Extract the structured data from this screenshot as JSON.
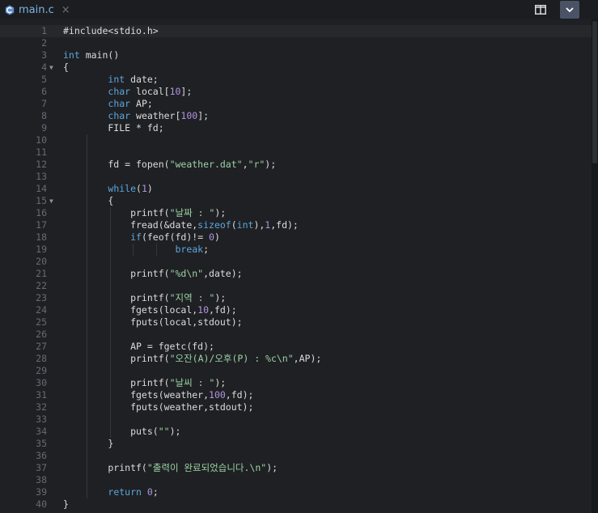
{
  "tab": {
    "filename": "main.c",
    "close_glyph": "×",
    "icon": "c-file-icon"
  },
  "toolbar": {
    "split_icon": "split-layout-icon",
    "dropdown_icon": "chevron-down-icon"
  },
  "colors": {
    "keyword": "#5ba6df",
    "number": "#b294e0",
    "string": "#9bd2a5",
    "text": "#dcdcdc",
    "tab_text": "#7fb2e5",
    "line_number": "#646b76"
  },
  "current_line": 1,
  "fold_lines": [
    4,
    15
  ],
  "lines": [
    [
      {
        "t": "#include<stdio.h>",
        "c": "plain"
      }
    ],
    [],
    [
      {
        "t": "int",
        "c": "kw"
      },
      {
        "t": " main()",
        "c": "plain"
      }
    ],
    [
      {
        "t": "{",
        "c": "plain"
      }
    ],
    [
      {
        "t": "        ",
        "c": "plain"
      },
      {
        "t": "int",
        "c": "kw"
      },
      {
        "t": " date;",
        "c": "plain"
      }
    ],
    [
      {
        "t": "        ",
        "c": "plain"
      },
      {
        "t": "char",
        "c": "kw"
      },
      {
        "t": " local[",
        "c": "plain"
      },
      {
        "t": "10",
        "c": "num"
      },
      {
        "t": "];",
        "c": "plain"
      }
    ],
    [
      {
        "t": "        ",
        "c": "plain"
      },
      {
        "t": "char",
        "c": "kw"
      },
      {
        "t": " AP;",
        "c": "plain"
      }
    ],
    [
      {
        "t": "        ",
        "c": "plain"
      },
      {
        "t": "char",
        "c": "kw"
      },
      {
        "t": " weather[",
        "c": "plain"
      },
      {
        "t": "100",
        "c": "num"
      },
      {
        "t": "];",
        "c": "plain"
      }
    ],
    [
      {
        "t": "        FILE * fd;",
        "c": "plain"
      }
    ],
    [],
    [],
    [
      {
        "t": "        fd = fopen(",
        "c": "plain"
      },
      {
        "t": "\"weather.dat\"",
        "c": "str"
      },
      {
        "t": ",",
        "c": "plain"
      },
      {
        "t": "\"r\"",
        "c": "str"
      },
      {
        "t": ");",
        "c": "plain"
      }
    ],
    [],
    [
      {
        "t": "        ",
        "c": "plain"
      },
      {
        "t": "while",
        "c": "kw"
      },
      {
        "t": "(",
        "c": "plain"
      },
      {
        "t": "1",
        "c": "num"
      },
      {
        "t": ")",
        "c": "plain"
      }
    ],
    [
      {
        "t": "        {",
        "c": "plain"
      }
    ],
    [
      {
        "t": "            printf(",
        "c": "plain"
      },
      {
        "t": "\"날짜 : \"",
        "c": "str"
      },
      {
        "t": ");",
        "c": "plain"
      }
    ],
    [
      {
        "t": "            fread(&date,",
        "c": "plain"
      },
      {
        "t": "sizeof",
        "c": "kw"
      },
      {
        "t": "(",
        "c": "plain"
      },
      {
        "t": "int",
        "c": "kw"
      },
      {
        "t": "),",
        "c": "plain"
      },
      {
        "t": "1",
        "c": "num"
      },
      {
        "t": ",fd);",
        "c": "plain"
      }
    ],
    [
      {
        "t": "            ",
        "c": "plain"
      },
      {
        "t": "if",
        "c": "kw"
      },
      {
        "t": "(feof(fd)!= ",
        "c": "plain"
      },
      {
        "t": "0",
        "c": "num"
      },
      {
        "t": ")",
        "c": "plain"
      }
    ],
    [
      {
        "t": "                    ",
        "c": "plain"
      },
      {
        "t": "break",
        "c": "kw"
      },
      {
        "t": ";",
        "c": "plain"
      }
    ],
    [],
    [
      {
        "t": "            printf(",
        "c": "plain"
      },
      {
        "t": "\"%d\\n\"",
        "c": "str"
      },
      {
        "t": ",date);",
        "c": "plain"
      }
    ],
    [],
    [
      {
        "t": "            printf(",
        "c": "plain"
      },
      {
        "t": "\"지역 : \"",
        "c": "str"
      },
      {
        "t": ");",
        "c": "plain"
      }
    ],
    [
      {
        "t": "            fgets(local,",
        "c": "plain"
      },
      {
        "t": "10",
        "c": "num"
      },
      {
        "t": ",fd);",
        "c": "plain"
      }
    ],
    [
      {
        "t": "            fputs(local,stdout);",
        "c": "plain"
      }
    ],
    [],
    [
      {
        "t": "            AP = fgetc(fd);",
        "c": "plain"
      }
    ],
    [
      {
        "t": "            printf(",
        "c": "plain"
      },
      {
        "t": "\"오잔(A)/오후(P) : %c\\n\"",
        "c": "str"
      },
      {
        "t": ",AP);",
        "c": "plain"
      }
    ],
    [],
    [
      {
        "t": "            printf(",
        "c": "plain"
      },
      {
        "t": "\"날씨 : \"",
        "c": "str"
      },
      {
        "t": ");",
        "c": "plain"
      }
    ],
    [
      {
        "t": "            fgets(weather,",
        "c": "plain"
      },
      {
        "t": "100",
        "c": "num"
      },
      {
        "t": ",fd);",
        "c": "plain"
      }
    ],
    [
      {
        "t": "            fputs(weather,stdout);",
        "c": "plain"
      }
    ],
    [],
    [
      {
        "t": "            puts(",
        "c": "plain"
      },
      {
        "t": "\"\"",
        "c": "str"
      },
      {
        "t": ");",
        "c": "plain"
      }
    ],
    [
      {
        "t": "        }",
        "c": "plain"
      }
    ],
    [],
    [
      {
        "t": "        printf(",
        "c": "plain"
      },
      {
        "t": "\"출력이 완료되었습니다.\\n\"",
        "c": "str"
      },
      {
        "t": ");",
        "c": "plain"
      }
    ],
    [],
    [
      {
        "t": "        ",
        "c": "plain"
      },
      {
        "t": "return",
        "c": "kw"
      },
      {
        "t": " ",
        "c": "plain"
      },
      {
        "t": "0",
        "c": "num"
      },
      {
        "t": ";",
        "c": "plain"
      }
    ],
    [
      {
        "t": "}",
        "c": "plain"
      }
    ]
  ]
}
